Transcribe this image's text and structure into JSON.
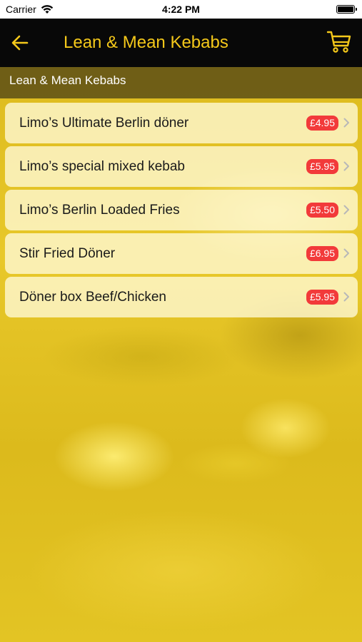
{
  "status_bar": {
    "carrier": "Carrier",
    "time": "4:22 PM"
  },
  "nav": {
    "back_icon": "arrow-left-icon",
    "title": "Lean & Mean Kebabs",
    "cart_icon": "cart-icon",
    "accent_color": "#f4c81a",
    "background_color": "#080808"
  },
  "section": {
    "title": "Lean & Mean Kebabs"
  },
  "menu": {
    "items": [
      {
        "name": "Limo’s Ultimate Berlin döner",
        "price": "£4.95"
      },
      {
        "name": "Limo’s special mixed kebab",
        "price": "£5.95"
      },
      {
        "name": "Limo’s Berlin Loaded Fries",
        "price": "£5.50"
      },
      {
        "name": "Stir Fried Döner",
        "price": "£6.95"
      },
      {
        "name": "Döner box Beef/Chicken",
        "price": "£5.95"
      }
    ],
    "price_badge_color": "#f23a3a"
  }
}
